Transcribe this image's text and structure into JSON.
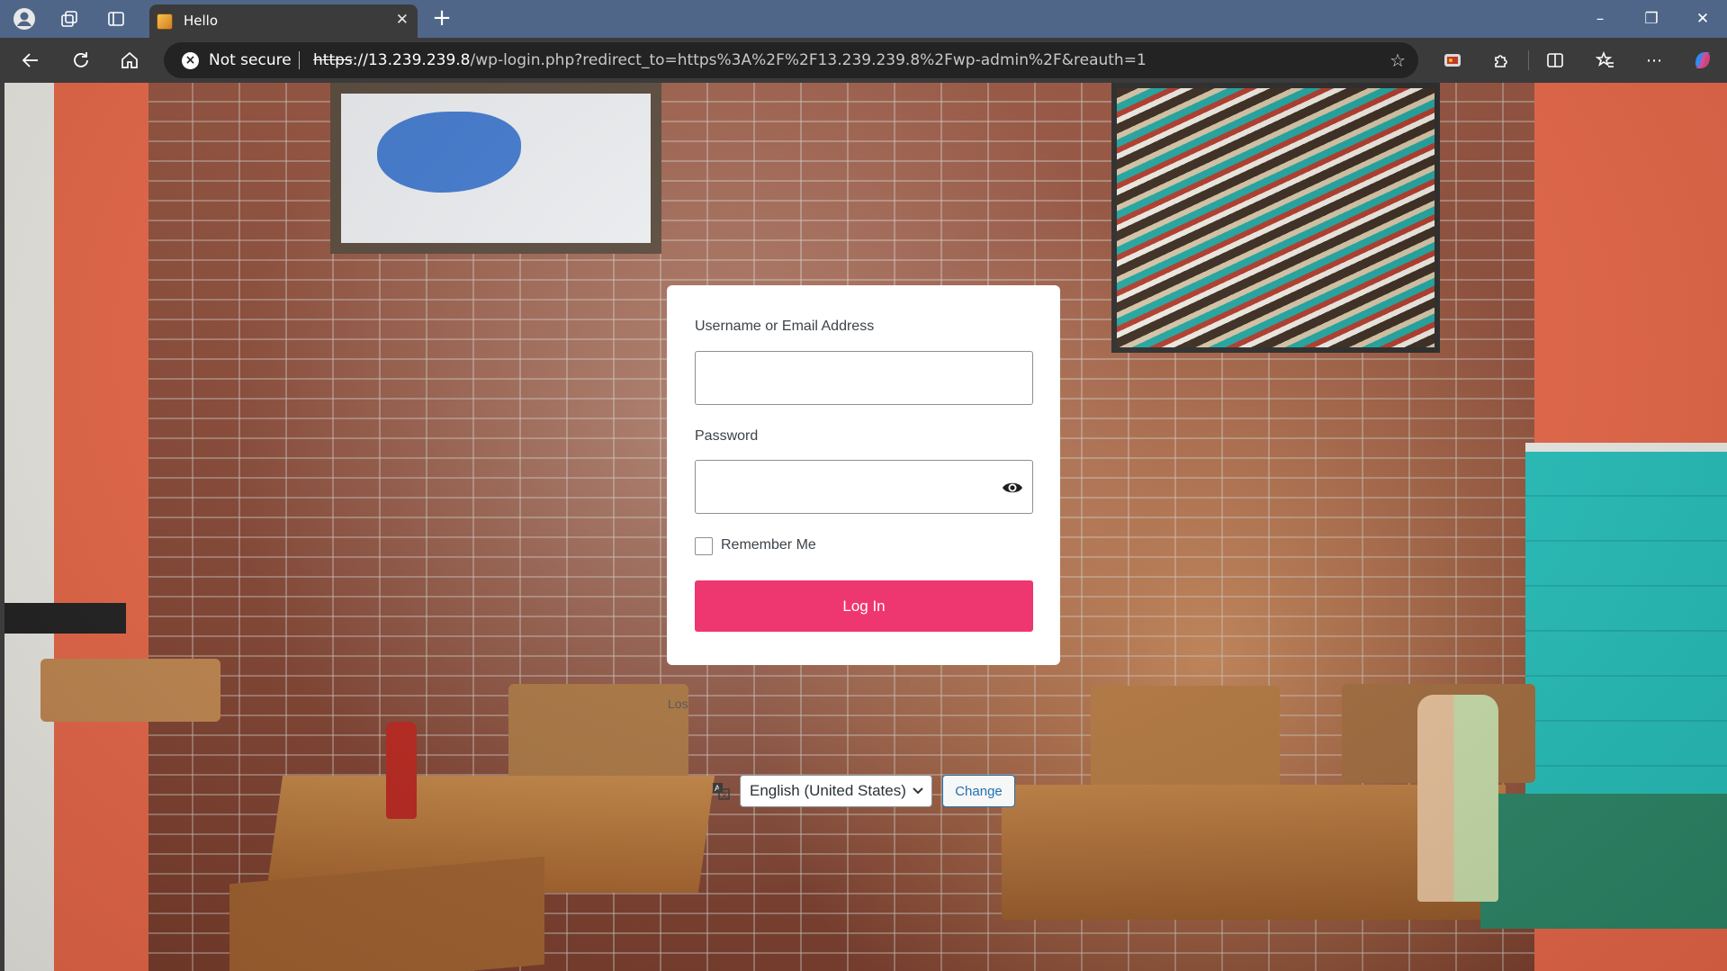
{
  "browser": {
    "tab_title": "Hello",
    "tab_close": "✕",
    "new_tab": "+",
    "security_label": "Not secure",
    "url_scheme": "https",
    "url_host": "://13.239.239.8",
    "url_rest": "/wp-login.php?redirect_to=https%3A%2F%2F13.239.239.8%2Fwp-admin%2F&reauth=1",
    "win_minimize": "–",
    "win_restore": "❐",
    "win_close": "✕"
  },
  "login": {
    "username_label": "Username or Email Address",
    "username_value": "",
    "password_label": "Password",
    "password_value": "",
    "remember_label": "Remember Me",
    "remember_checked": false,
    "submit_label": "Log In",
    "lost_password_partial": "Los"
  },
  "language": {
    "selected": "English (United States)",
    "change_label": "Change"
  },
  "colors": {
    "accent": "#ee3670",
    "link": "#2271b1",
    "titlebar": "#4f6688",
    "toolbar": "#3b3b3b"
  }
}
